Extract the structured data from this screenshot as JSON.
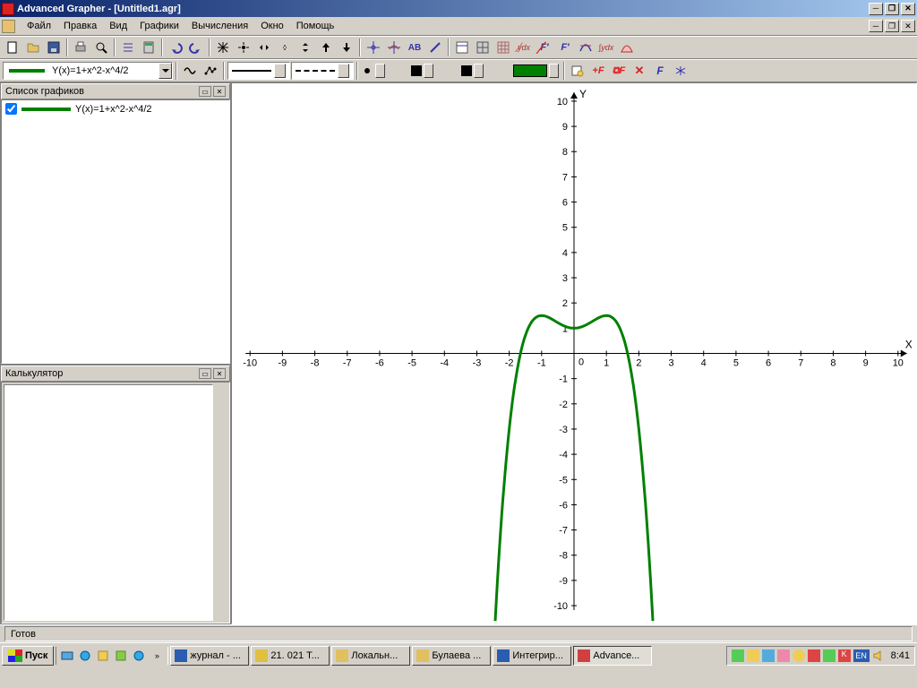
{
  "title": "Advanced Grapher - [Untitled1.agr]",
  "menu": [
    "Файл",
    "Правка",
    "Вид",
    "Графики",
    "Вычисления",
    "Окно",
    "Помощь"
  ],
  "formula_combo": "Y(x)=1+x^2-x^4/2",
  "panels": {
    "graph_list": "Список графиков",
    "calculator": "Калькулятор"
  },
  "graph_list_item": "Y(x)=1+x^2-x^4/2",
  "status": "Готов",
  "start": "Пуск",
  "tasks": [
    {
      "label": "журнал - ...",
      "color": "#2a5db0"
    },
    {
      "label": "21. 021 Т...",
      "color": "#e0c040"
    },
    {
      "label": "Локальн...",
      "color": "#e0c060"
    },
    {
      "label": "Булаева ...",
      "color": "#e0c060"
    },
    {
      "label": "Интегрир...",
      "color": "#2a5db0"
    },
    {
      "label": "Advance...",
      "color": "#d04040",
      "active": true
    }
  ],
  "lang": "EN",
  "clock": "8:41",
  "colors": {
    "curve": "#008000"
  },
  "chart_data": {
    "type": "line",
    "title": "",
    "xlabel": "X",
    "ylabel": "Y",
    "xlim": [
      -10,
      10
    ],
    "ylim": [
      -10,
      10
    ],
    "xticks": [
      -10,
      -9,
      -8,
      -7,
      -6,
      -5,
      -4,
      -3,
      -2,
      -1,
      0,
      1,
      2,
      3,
      4,
      5,
      6,
      7,
      8,
      9,
      10
    ],
    "yticks": [
      -10,
      -9,
      -8,
      -7,
      -6,
      -5,
      -4,
      -3,
      -2,
      -1,
      0,
      1,
      2,
      3,
      4,
      5,
      6,
      7,
      8,
      9,
      10
    ],
    "series": [
      {
        "name": "Y(x)=1+x^2-x^4/2",
        "formula": "1 + x^2 - x^4/2",
        "color": "#008000",
        "width": 3
      }
    ]
  }
}
